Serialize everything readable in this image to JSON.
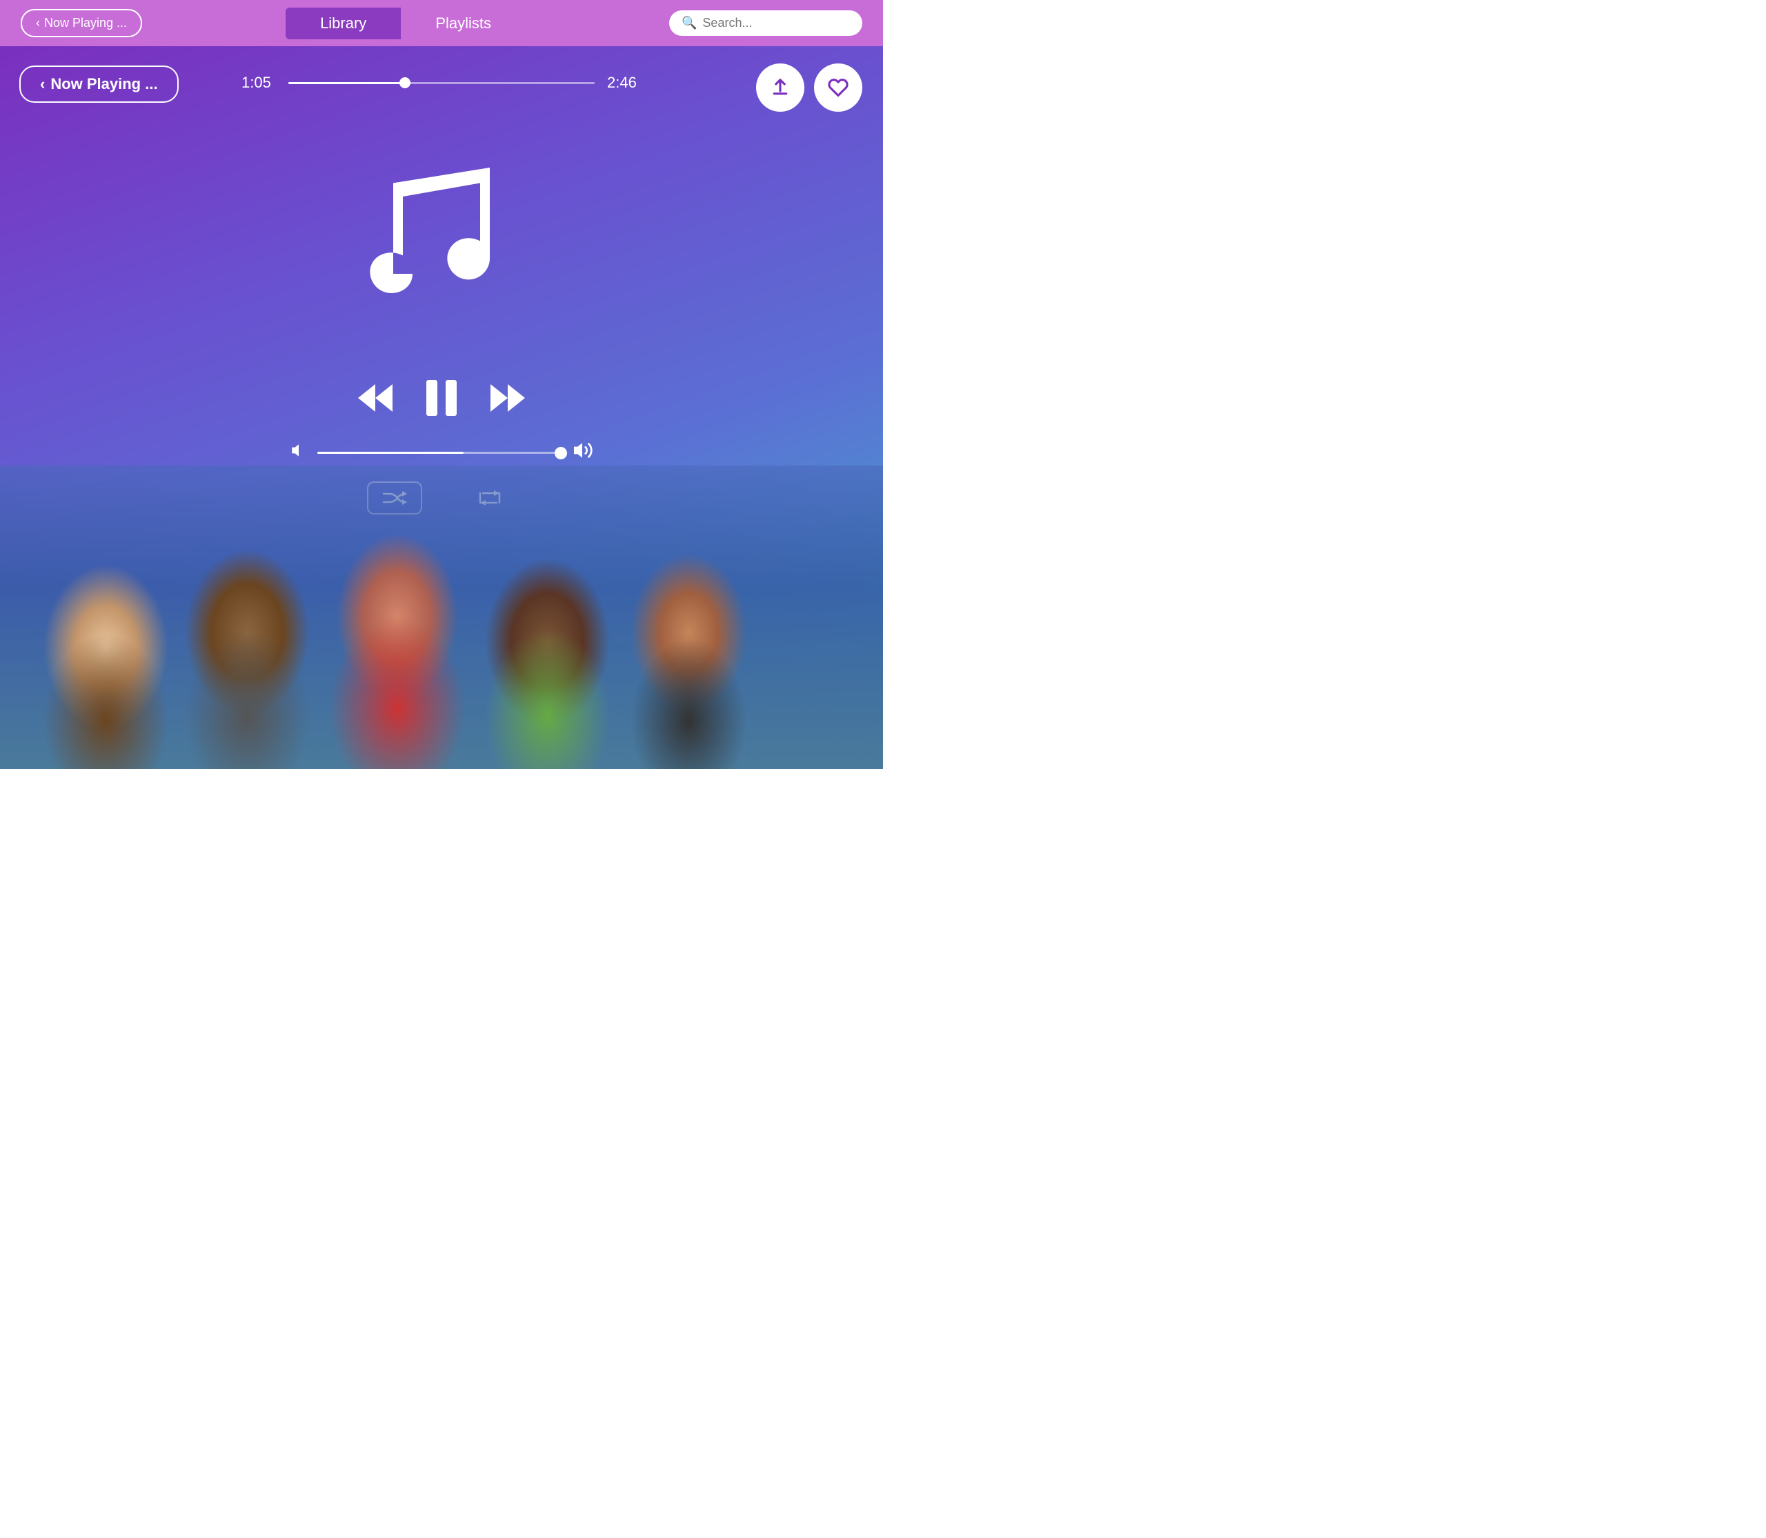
{
  "nav": {
    "now_playing_label": "Now Playing ...",
    "library_label": "Library",
    "playlists_label": "Playlists",
    "search_placeholder": "Search..."
  },
  "player": {
    "now_playing_label": "Now Playing ...",
    "current_time": "1:05",
    "total_time": "2:46",
    "progress_pct": 38,
    "volume_pct": 60,
    "music_note": "♫"
  },
  "controls": {
    "rewind_label": "⏮",
    "pause_label": "⏸",
    "fast_forward_label": "⏭",
    "volume_low_icon": "🔇",
    "volume_high_icon": "🔊",
    "shuffle_icon": "⇌",
    "repeat_icon": "↺",
    "share_icon": "⬆",
    "like_icon": "♥"
  }
}
